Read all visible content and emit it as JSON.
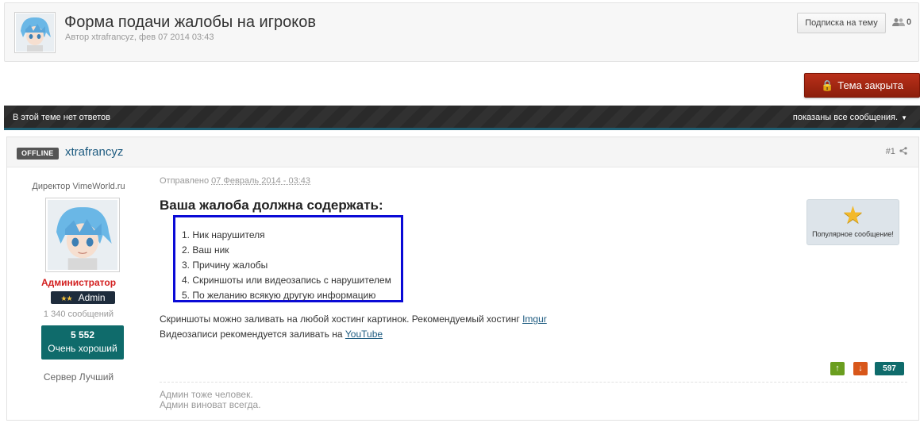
{
  "header": {
    "title": "Форма подачи жалобы на игроков",
    "meta": "Автор xtrafrancyz, фев 07 2014 03:43",
    "subscribe_label": "Подписка на тему",
    "followers_count": "0"
  },
  "closed_button": {
    "label": "Тема закрыта"
  },
  "bar": {
    "left_text": "В этой теме нет ответов",
    "right_text": "показаны все сообщения."
  },
  "post": {
    "status_badge": "OFFLINE",
    "author": "xtrafrancyz",
    "number": "#1",
    "user_title": "Директор VimeWorld.ru",
    "group": "Администратор",
    "rank_stars": "★★",
    "rank": "Admin",
    "post_count": "1 340 сообщений",
    "reputation_value": "5 552",
    "reputation_label": "Очень хороший",
    "server": "Сервер Лучший",
    "posted_prefix": "Отправлено",
    "posted_date": "07 Февраль 2014 - 03:43",
    "heading": "Ваша жалоба должна содержать:",
    "rules": [
      "1. Ник нарушителя",
      "2. Ваш ник",
      "3. Причину жалобы",
      "4. Скриншоты или видеозапись с нарушителем",
      "5. По желанию всякую другую информацию"
    ],
    "line1_text": "Скриншоты можно заливать на любой хостинг картинок. Рекомендуемый хостинг ",
    "line1_link": "Imgur",
    "line2_text": "Видеозаписи рекомендуется заливать на ",
    "line2_link": "YouTube",
    "popular_label": "Популярное сообщение!",
    "post_reputation": "597",
    "signature_line1": "Админ тоже человек.",
    "signature_line2": "Админ виноват всегда."
  },
  "colors": {
    "accent_link": "#1d5b80",
    "closed_button": "#a82813",
    "rules_border": "#0a0ad6",
    "reputation_bg": "#0f6b6b",
    "group_color": "#d32020"
  }
}
